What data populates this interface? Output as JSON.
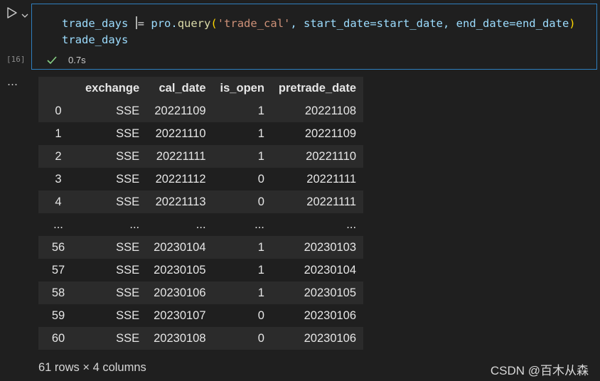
{
  "cell": {
    "exec_count": "[16]",
    "status_time": "0.7s",
    "code": {
      "line1": {
        "var": "trade_days",
        "eq": "=",
        "obj": "pro.",
        "fn": "query",
        "open": "(",
        "str": "'trade_cal'",
        "rest": ", start_date=start_date, end_date=end_date",
        "close": ")"
      },
      "line2": "trade_days"
    }
  },
  "output": {
    "more": "…",
    "table": {
      "columns": [
        "",
        "exchange",
        "cal_date",
        "is_open",
        "pretrade_date"
      ],
      "rows": [
        [
          "0",
          "SSE",
          "20221109",
          "1",
          "20221108"
        ],
        [
          "1",
          "SSE",
          "20221110",
          "1",
          "20221109"
        ],
        [
          "2",
          "SSE",
          "20221111",
          "1",
          "20221110"
        ],
        [
          "3",
          "SSE",
          "20221112",
          "0",
          "20221111"
        ],
        [
          "4",
          "SSE",
          "20221113",
          "0",
          "20221111"
        ],
        [
          "...",
          "...",
          "...",
          "...",
          "..."
        ],
        [
          "56",
          "SSE",
          "20230104",
          "1",
          "20230103"
        ],
        [
          "57",
          "SSE",
          "20230105",
          "1",
          "20230104"
        ],
        [
          "58",
          "SSE",
          "20230106",
          "1",
          "20230105"
        ],
        [
          "59",
          "SSE",
          "20230107",
          "0",
          "20230106"
        ],
        [
          "60",
          "SSE",
          "20230108",
          "0",
          "20230106"
        ]
      ]
    },
    "shape": "61 rows × 4 columns"
  },
  "watermark": "CSDN @百木从森",
  "colors": {
    "background": "#1f1f1f",
    "cell_border": "#2f7fbf",
    "success": "#89d185",
    "string": "#ce9178",
    "function": "#dcdcaa",
    "variable": "#9cdcfe",
    "bracket": "#ffd700"
  },
  "icons": {
    "run": "play-icon",
    "run_menu": "chevron-down-icon",
    "status": "check-icon",
    "output_actions": "ellipsis-icon"
  }
}
